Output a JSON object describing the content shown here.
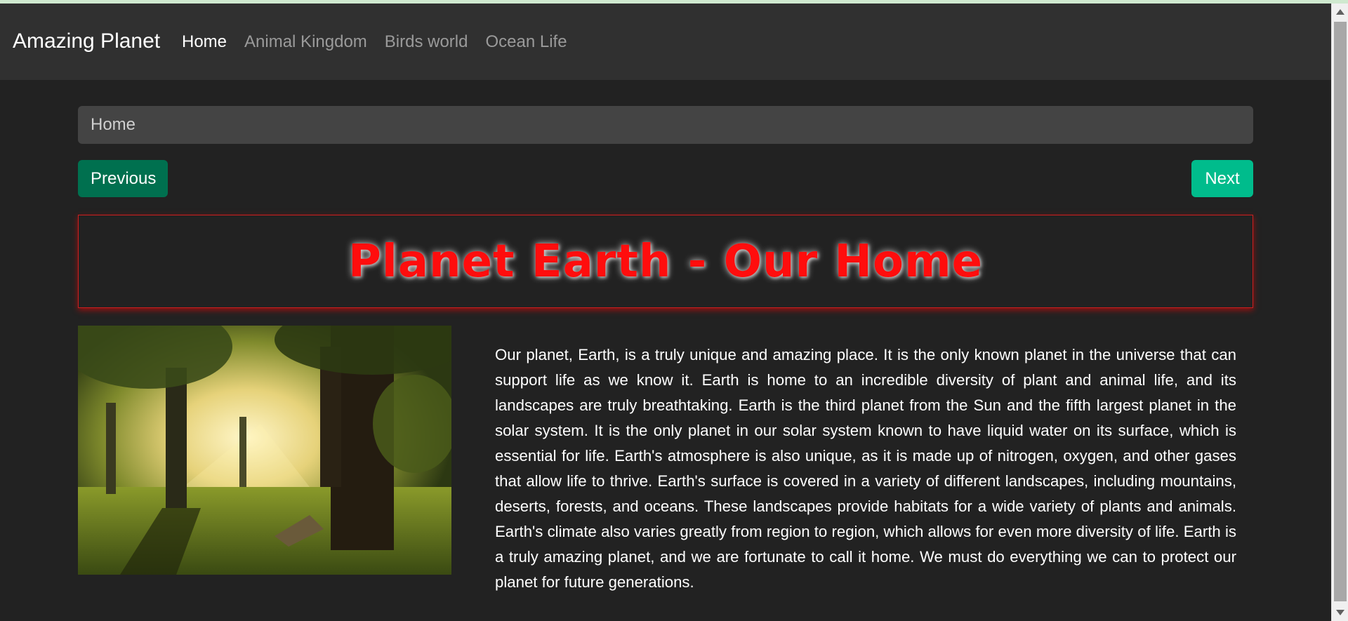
{
  "navbar": {
    "brand": "Amazing Planet",
    "links": [
      {
        "label": "Home",
        "active": true
      },
      {
        "label": "Animal Kingdom",
        "active": false
      },
      {
        "label": "Birds world",
        "active": false
      },
      {
        "label": "Ocean Life",
        "active": false
      }
    ]
  },
  "breadcrumb": {
    "current": "Home"
  },
  "pager": {
    "previous_label": "Previous",
    "next_label": "Next"
  },
  "hero": {
    "title": "Planet Earth - Our Home"
  },
  "article": {
    "image_subject": "forest with sunlight through trees",
    "text": "Our planet, Earth, is a truly unique and amazing place. It is the only known planet in the universe that can support life as we know it. Earth is home to an incredible diversity of plant and animal life, and its landscapes are truly breathtaking. Earth is the third planet from the Sun and the fifth largest planet in the solar system. It is the only planet in our solar system known to have liquid water on its surface, which is essential for life. Earth's atmosphere is also unique, as it is made up of nitrogen, oxygen, and other gases that allow life to thrive. Earth's surface is covered in a variety of different landscapes, including mountains, deserts, forests, and oceans. These landscapes provide habitats for a wide variety of plants and animals. Earth's climate also varies greatly from region to region, which allows for even more diversity of life. Earth is a truly amazing planet, and we are fortunate to call it home. We must do everything we can to protect our planet for future generations."
  },
  "colors": {
    "background": "#222222",
    "navbar": "#303030",
    "breadcrumb": "#444444",
    "previous_button": "#00704f",
    "next_button": "#00bc8c",
    "title_red": "#ff0d0d"
  }
}
